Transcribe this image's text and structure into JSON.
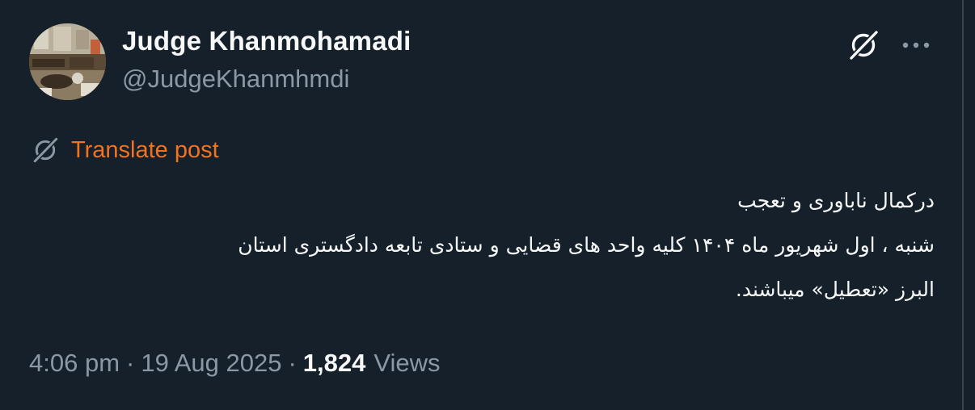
{
  "author": {
    "display_name": "Judge Khanmohamadi",
    "handle": "@JudgeKhanmhmdi"
  },
  "header_actions": {
    "grok_icon": "grok-slash-icon",
    "more_icon": "more-horizontal-icon"
  },
  "translate": {
    "icon": "grok-slash-icon",
    "label": "Translate post"
  },
  "post": {
    "lines": [
      "درکمال ناباوری و تعجب",
      "شنبه ، اول شهریور ماه ۱۴۰۴ کلیه واحد های قضایی و ستادی تابعه دادگستری استان",
      "البرز «تعطیل» میباشند."
    ]
  },
  "meta": {
    "time": "4:06 pm",
    "separator": "·",
    "date": "19 Aug 2025",
    "views_count": "1,824",
    "views_label": "Views"
  },
  "colors": {
    "background": "#15202b",
    "text_primary": "#f7f9f9",
    "text_secondary": "#8b98a5",
    "translate_accent": "#f4711d"
  }
}
